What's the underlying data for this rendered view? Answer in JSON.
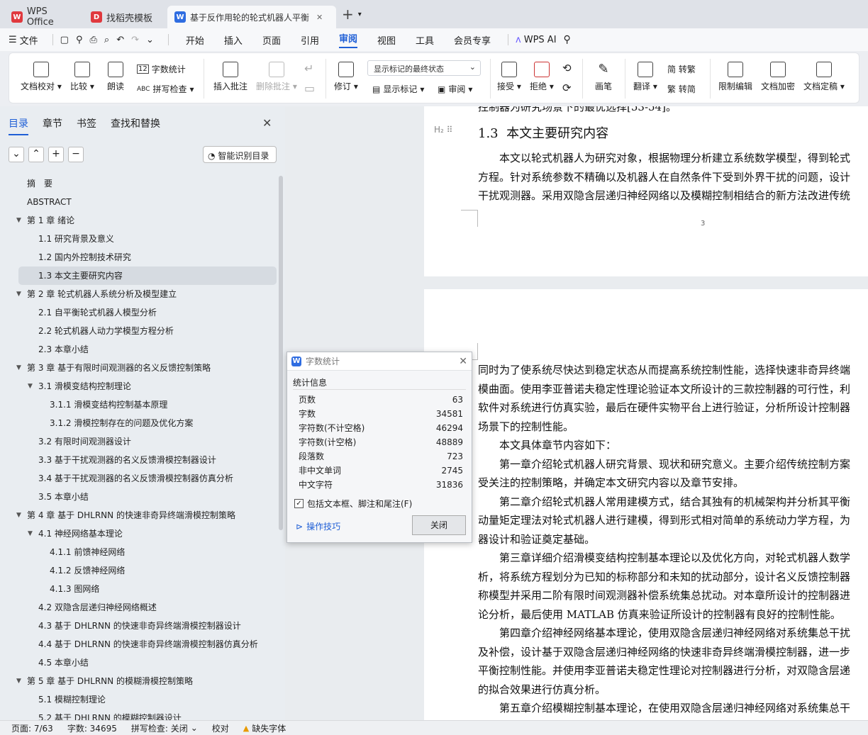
{
  "tabs": [
    {
      "label": "WPS Office"
    },
    {
      "label": "找稻壳模板"
    },
    {
      "label": "基于反作用轮的轮式机器人平衡"
    }
  ],
  "menu": {
    "file": "文件",
    "nav": [
      "开始",
      "插入",
      "页面",
      "引用",
      "审阅",
      "视图",
      "工具",
      "会员专享"
    ],
    "ai": "WPS AI"
  },
  "ribbon": {
    "doc_proofread": "文档校对",
    "compare": "比较",
    "read_aloud": "朗读",
    "word_count": "字数统计",
    "spell_check": "拼写检查",
    "insert_comment": "插入批注",
    "delete_comment": "删除批注",
    "revise": "修订",
    "markup_select": "显示标记的最终状态",
    "show_markup": "显示标记",
    "review": "审阅",
    "accept": "接受",
    "reject": "拒绝",
    "pen": "画笔",
    "translate": "翻译",
    "to_traditional": "简 转繁",
    "to_simplified": "繁 转简",
    "restrict_edit": "限制编辑",
    "doc_encrypt": "文档加密",
    "doc_finalize": "文档定稿"
  },
  "navpanel": {
    "tabs": [
      "目录",
      "章节",
      "书签",
      "查找和替换"
    ],
    "smart_btn": "智能识别目录",
    "toc": [
      {
        "t": "摘　要",
        "lv": 0
      },
      {
        "t": "ABSTRACT",
        "lv": 0
      },
      {
        "t": "第 1 章  绪论",
        "lv": 0,
        "c": 1
      },
      {
        "t": "1.1  研究背景及意义",
        "lv": 1
      },
      {
        "t": "1.2  国内外控制技术研究",
        "lv": 1
      },
      {
        "t": "1.3  本文主要研究内容",
        "lv": 1,
        "sel": 1
      },
      {
        "t": "第 2 章  轮式机器人系统分析及模型建立",
        "lv": 0,
        "c": 1
      },
      {
        "t": "2.1  自平衡轮式机器人模型分析",
        "lv": 1
      },
      {
        "t": "2.2  轮式机器人动力学模型方程分析",
        "lv": 1
      },
      {
        "t": "2.3  本章小结",
        "lv": 1
      },
      {
        "t": "第 3 章  基于有限时间观测器的名义反馈控制策略",
        "lv": 0,
        "c": 1
      },
      {
        "t": "3.1  滑模变结构控制理论",
        "lv": 1,
        "c": 1
      },
      {
        "t": "3.1.1  滑模变结构控制基本原理",
        "lv": 2
      },
      {
        "t": "3.1.2  滑模控制存在的问题及优化方案",
        "lv": 2
      },
      {
        "t": "3.2  有限时间观测器设计",
        "lv": 1
      },
      {
        "t": "3.3  基于干扰观测器的名义反馈滑模控制器设计",
        "lv": 1
      },
      {
        "t": "3.4  基于干扰观测器的名义反馈滑模控制器仿真分析",
        "lv": 1
      },
      {
        "t": "3.5  本章小结",
        "lv": 1
      },
      {
        "t": "第 4 章  基于 DHLRNN 的快速非奇异终端滑模控制策略",
        "lv": 0,
        "c": 1
      },
      {
        "t": "4.1  神经网络基本理论",
        "lv": 1,
        "c": 1
      },
      {
        "t": "4.1.1  前馈神经网络",
        "lv": 2
      },
      {
        "t": "4.1.2  反馈神经网络",
        "lv": 2
      },
      {
        "t": "4.1.3  图网络",
        "lv": 2
      },
      {
        "t": "4.2  双隐含层递归神经网络概述",
        "lv": 1
      },
      {
        "t": "4.3  基于 DHLRNN 的快速非奇异终端滑模控制器设计",
        "lv": 1
      },
      {
        "t": "4.4  基于 DHLRNN 的快速非奇异终端滑模控制器仿真分析",
        "lv": 1
      },
      {
        "t": "4.5  本章小结",
        "lv": 1
      },
      {
        "t": "第 5 章  基于 DHLRNN 的模糊滑模控制策略",
        "lv": 0,
        "c": 1
      },
      {
        "t": "5.1  模糊控制理论",
        "lv": 1
      },
      {
        "t": "5.2  基于 DHLRNN 的模糊控制器设计",
        "lv": 1
      }
    ]
  },
  "doc": {
    "page1_top": "控制器为研究场景下的最优选择[53-54]。",
    "heading_num": "1.3",
    "heading_text": "本文主要研究内容",
    "p1": [
      "　　本文以轮式机器人为研究对象，根据物理分析建立系统数学模型，得到轮式",
      "方程。针对系统参数不精确以及机器人在自然条件下受到外界干扰的问题，设计",
      "干扰观测器。采用双隐含层递归神经网络以及模糊控制相结合的新方法改进传统"
    ],
    "page_number": "3",
    "p2": [
      "同时为了使系统尽快达到稳定状态从而提高系统控制性能，选择快速非奇异终端",
      "模曲面。使用李亚普诺夫稳定性理论验证本文所设计的三款控制器的可行性，利",
      "软件对系统进行仿真实验，最后在硬件实物平台上进行验证，分析所设计控制器",
      "场景下的控制性能。",
      "　　本文具体章节内容如下：",
      "　　第一章介绍轮式机器人研究背景、现状和研究意义。主要介绍传统控制方案",
      "受关注的控制策略，并确定本文研究内容以及章节安排。",
      "　　第二章介绍轮式机器人常用建模方式，结合其独有的机械架构并分析其平衡",
      "动量矩定理法对轮式机器人进行建模，得到形式相对简单的系统动力学方程，为",
      "器设计和验证奠定基础。",
      "　　第三章详细介绍滑模变结构控制基本理论以及优化方向，对轮式机器人数学",
      "析，将系统方程划分为已知的标称部分和未知的扰动部分，设计名义反馈控制器",
      "称模型并采用二阶有限时间观测器补偿系统集总扰动。对本章所设计的控制器进",
      "论分析，最后使用 MATLAB 仿真来验证所设计的控制器有良好的控制性能。",
      "　　第四章介绍神经网络基本理论，使用双隐含层递归神经网络对系统集总干扰",
      "及补偿，设计基于双隐含层递归神经网络的快速非奇异终端滑模控制器，进一步",
      "平衡控制性能。并使用李亚普诺夫稳定性理论对控制器进行分析，对双隐含层递",
      "的拟合效果进行仿真分析。",
      "　　第五章介绍模糊控制基本理论，在使用双隐含层递归神经网络对系统集总干"
    ]
  },
  "dialog": {
    "title": "字数统计",
    "group": "统计信息",
    "stats": [
      {
        "k": "页数",
        "v": "63"
      },
      {
        "k": "字数",
        "v": "34581"
      },
      {
        "k": "字符数(不计空格)",
        "v": "46294"
      },
      {
        "k": "字符数(计空格)",
        "v": "48889"
      },
      {
        "k": "段落数",
        "v": "723"
      },
      {
        "k": "非中文单词",
        "v": "2745"
      },
      {
        "k": "中文字符",
        "v": "31836"
      }
    ],
    "checkbox": "包括文本框、脚注和尾注(F)",
    "tips": "操作技巧",
    "close": "关闭"
  },
  "status": {
    "page": "页面: 7/63",
    "words": "字数: 34695",
    "spell": "拼写检查: 关闭",
    "proof": "校对",
    "missing_font": "缺失字体"
  },
  "colors": {
    "accent": "#1f5fd6",
    "wps_red": "#e0393e"
  }
}
